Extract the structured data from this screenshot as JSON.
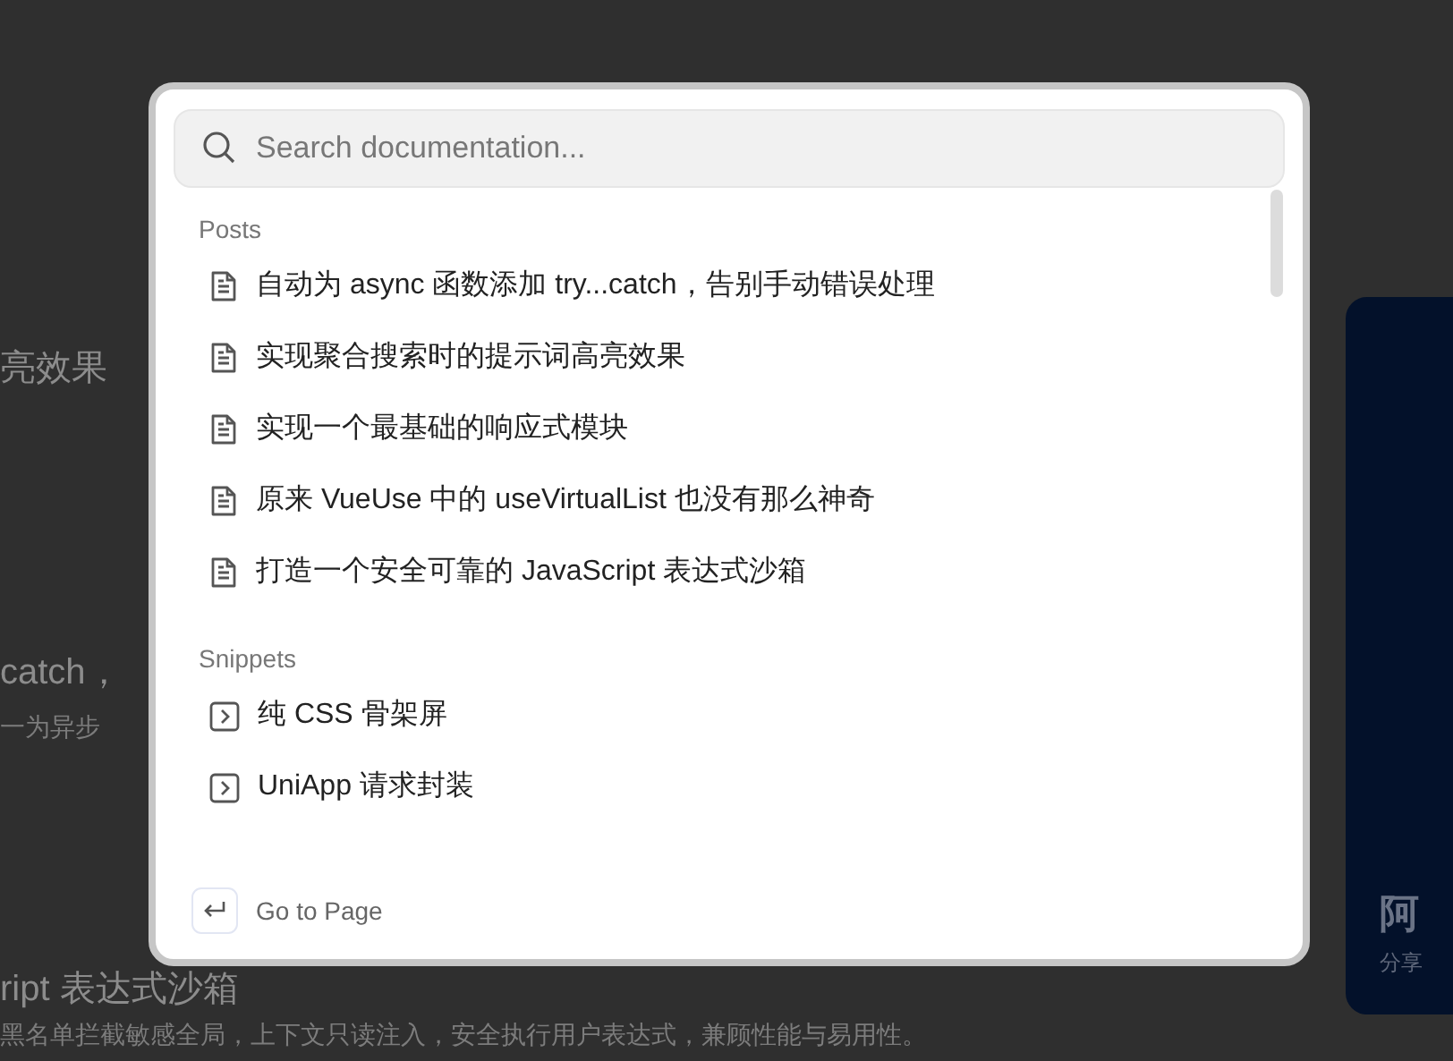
{
  "background_page": {
    "headings": [
      "亮效果",
      "catch，",
      "ript 表达式沙箱"
    ],
    "excerpts": [
      "一为异步",
      "黑名单拦截敏感全局，上下文只读注入，安全执行用户表达式，兼顾性能与易用性。"
    ],
    "side_card": {
      "title": "阿",
      "subtitle": "分享"
    }
  },
  "search_dialog": {
    "search": {
      "placeholder": "Search documentation..."
    },
    "groups": [
      {
        "heading": "Posts",
        "items": [
          {
            "kind": "post",
            "label": "自动为 async 函数添加 try...catch，告别手动错误处理"
          },
          {
            "kind": "post",
            "label": "实现聚合搜索时的提示词高亮效果"
          },
          {
            "kind": "post",
            "label": "实现一个最基础的响应式模块"
          },
          {
            "kind": "post",
            "label": "原来 VueUse 中的 useVirtualList 也没有那么神奇"
          },
          {
            "kind": "post",
            "label": "打造一个安全可靠的 JavaScript 表达式沙箱"
          }
        ]
      },
      {
        "heading": "Snippets",
        "items": [
          {
            "kind": "snippet",
            "label": "纯 CSS 骨架屏"
          },
          {
            "kind": "snippet",
            "label": "UniApp 请求封装"
          }
        ]
      }
    ],
    "footer": {
      "hint": "Go to Page"
    }
  }
}
